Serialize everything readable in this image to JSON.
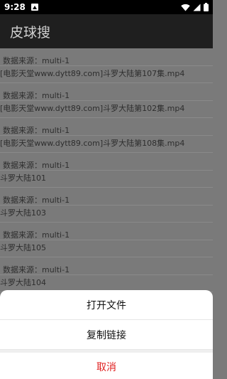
{
  "status_bar": {
    "time": "9:28"
  },
  "app": {
    "title": "皮球搜"
  },
  "results": [
    {
      "source": "数据来源：multi-1",
      "name": "[电影天堂www.dytt89.com]斗罗大陆第107集.mp4"
    },
    {
      "source": "数据来源：multi-1",
      "name": "[电影天堂www.dytt89.com]斗罗大陆第102集.mp4"
    },
    {
      "source": "数据来源：multi-1",
      "name": "[电影天堂www.dytt89.com]斗罗大陆第108集.mp4"
    },
    {
      "source": "数据来源：multi-1",
      "name": "斗罗大陆101"
    },
    {
      "source": "数据来源：multi-1",
      "name": "斗罗大陆103"
    },
    {
      "source": "数据来源：multi-1",
      "name": "斗罗大陆105"
    },
    {
      "source": "数据来源：multi-1",
      "name": "斗罗大陆104"
    }
  ],
  "action_sheet": {
    "open_file": "打开文件",
    "copy_link": "复制链接",
    "cancel": "取消"
  }
}
